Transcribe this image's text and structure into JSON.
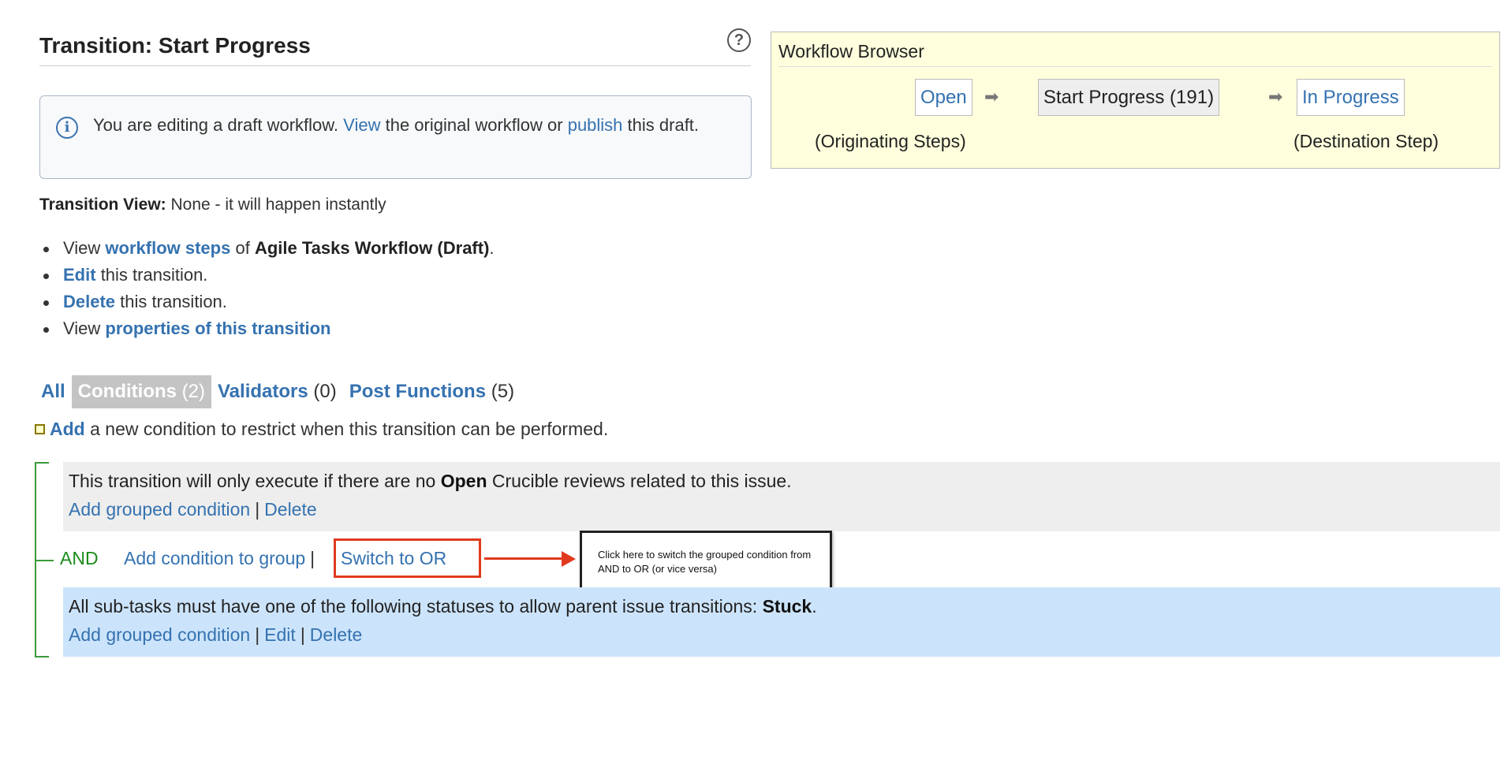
{
  "header": {
    "title": "Transition: Start Progress",
    "help_icon": "question-circle-icon"
  },
  "info": {
    "text_before": "You are editing a draft workflow.",
    "view_link": "View",
    "text_middle": "the original workflow or",
    "publish_link": "publish",
    "text_after": "this draft."
  },
  "workflow_browser": {
    "title": "Workflow Browser",
    "origin_step": "Open",
    "transition": "Start Progress (191)",
    "destination_step": "In Progress",
    "origin_caption": "(Originating Steps)",
    "destination_caption": "(Destination Step)"
  },
  "transition_view": {
    "label": "Transition View:",
    "value": "None - it will happen instantly"
  },
  "actions": [
    {
      "pre": "View",
      "link": "workflow steps",
      "mid": "of",
      "bold": "Agile Tasks Workflow (Draft)",
      "post": "."
    },
    {
      "link": "Edit",
      "post": "this transition."
    },
    {
      "link": "Delete",
      "post": "this transition."
    },
    {
      "pre": "View",
      "link": "properties of this transition"
    }
  ],
  "tabs": [
    {
      "label": "All",
      "count": ""
    },
    {
      "label": "Conditions",
      "count": "(2)",
      "active": true
    },
    {
      "label": "Validators",
      "count": "(0)"
    },
    {
      "label": "Post Functions",
      "count": "(5)"
    }
  ],
  "add_condition": {
    "link": "Add",
    "text": "a new condition to restrict when this transition can be performed."
  },
  "conditions": [
    {
      "text_before": "This transition will only execute if there are no",
      "bold": "Open",
      "text_after": "Crucible reviews related to this issue.",
      "links": [
        "Add grouped condition",
        "Delete"
      ]
    },
    {
      "text_before": "All sub-tasks must have one of the following statuses to allow parent issue transitions:",
      "bold": "Stuck",
      "text_after": ".",
      "links": [
        "Add grouped condition",
        "Edit",
        "Delete"
      ]
    }
  ],
  "group": {
    "operator": "AND",
    "add_link": "Add condition to group",
    "switch_link": "Switch to OR"
  },
  "annotation": {
    "text": "Click here to switch the grouped condition from AND to OR (or vice versa)"
  },
  "colors": {
    "link": "#3572b0",
    "tree_line": "#3a9a3a",
    "highlight_red": "#e03a1e",
    "workflow_bg": "#ffffdd",
    "condition2_bg": "#cce4fb"
  }
}
